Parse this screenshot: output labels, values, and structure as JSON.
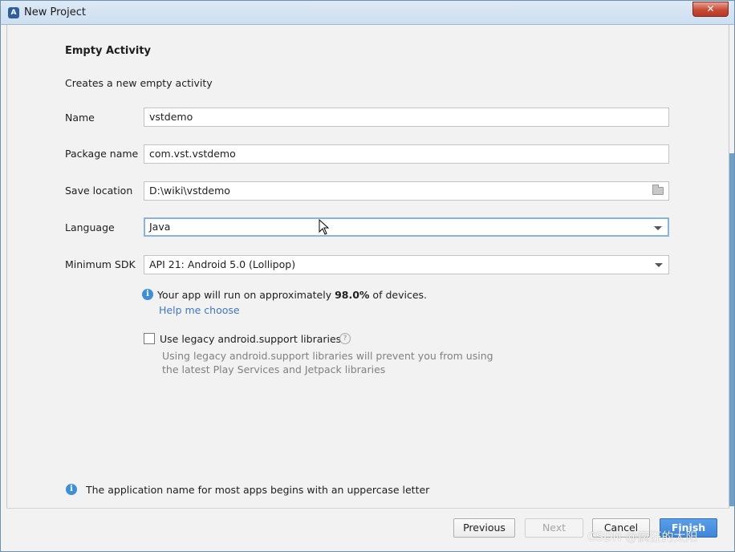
{
  "window": {
    "title": "New Project",
    "close_label": "✕"
  },
  "page": {
    "heading": "Empty Activity",
    "description": "Creates a new empty activity"
  },
  "form": {
    "name_label": "Name",
    "name_value": "vstdemo",
    "package_label": "Package name",
    "package_value": "com.vst.vstdemo",
    "location_label": "Save location",
    "location_value": "D:\\wiki\\vstdemo",
    "language_label": "Language",
    "language_value": "Java",
    "sdk_label": "Minimum SDK",
    "sdk_value": "API 21: Android 5.0 (Lollipop)"
  },
  "sdk_info": {
    "prefix": "Your app will run on approximately ",
    "percent": "98.0%",
    "suffix": " of devices.",
    "help_link": "Help me choose"
  },
  "legacy": {
    "checkbox_label": "Use legacy android.support libraries",
    "checked": false,
    "help_glyph": "?",
    "note_line1": "Using legacy android.support libraries will prevent you from using",
    "note_line2": "the latest Play Services and Jetpack libraries"
  },
  "hint": "The application name for most apps begins with an uppercase letter",
  "footer": {
    "previous": "Previous",
    "next": "Next",
    "cancel": "Cancel",
    "finish": "Finish"
  },
  "watermark": "CSDN @疯狂的太阳",
  "icons": {
    "app": "android-studio-icon",
    "info": "info-icon",
    "folder": "folder-icon"
  },
  "colors": {
    "accent": "#3c8fd8",
    "link": "#3c78c4",
    "primary_button": "#3f86d8"
  }
}
